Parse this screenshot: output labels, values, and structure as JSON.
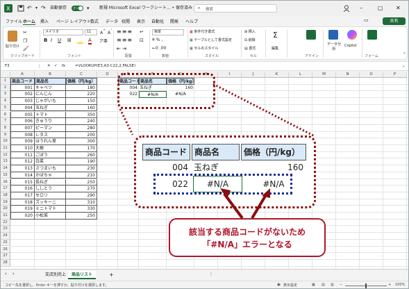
{
  "window": {
    "autosave_label": "自動保存",
    "autosave_state": "オン",
    "doc_title": "新規 Microsoft Excel ワークシート... • 保存済み",
    "search_placeholder": "検索",
    "share_label": "共有"
  },
  "menu": [
    "ファイル",
    "ホーム",
    "挿入",
    "ページ レイアウト",
    "数式",
    "データ",
    "校閲",
    "表示",
    "自動化",
    "開発",
    "ヘルプ"
  ],
  "ribbon": {
    "paste": "貼り付け",
    "font_name": "メイリオ",
    "font_size": "11",
    "number_format": "標準",
    "cond_format": "条件付き書式",
    "table_format": "テーブルとして書式設定",
    "cell_styles": "セルのスタイル",
    "insert": "挿入",
    "delete": "削除",
    "format": "書式",
    "edit": "編集",
    "data_analysis": "データ分析",
    "copilot": "Copilot",
    "groups": [
      "クリップボード",
      "フォント",
      "配置",
      "数値",
      "スタイル",
      "セル",
      "アドイン",
      "フォーム"
    ]
  },
  "formula_bar": {
    "cell_ref": "F3",
    "fx": "fx",
    "formula": "=VLOOKUP(E3,A3:C22,2,FALSE)"
  },
  "columns": [
    "A",
    "B",
    "C",
    "D",
    "E",
    "F",
    "G",
    "H",
    "I",
    "J",
    "K",
    "L",
    "M",
    "N",
    "O",
    "P"
  ],
  "rows": [
    "1",
    "2",
    "3",
    "4",
    "5",
    "6",
    "7",
    "8",
    "9",
    "10",
    "11",
    "12",
    "13",
    "14",
    "15",
    "16",
    "17",
    "18",
    "19",
    "20",
    "21",
    "22",
    "23",
    "24",
    "25",
    "26",
    "27",
    "28"
  ],
  "table": {
    "headers": [
      "商品コード",
      "商品名",
      "価格（円/kg）"
    ],
    "rows": [
      [
        "001",
        "キャベツ",
        "180"
      ],
      [
        "002",
        "にんじん",
        "220"
      ],
      [
        "003",
        "じゃがいも",
        "150"
      ],
      [
        "004",
        "玉ねぎ",
        "160"
      ],
      [
        "005",
        "トマト",
        "350"
      ],
      [
        "006",
        "きゅうり",
        "240"
      ],
      [
        "007",
        "ピーマン",
        "280"
      ],
      [
        "008",
        "レタス",
        "200"
      ],
      [
        "009",
        "ほうれん草",
        "300"
      ],
      [
        "010",
        "大根",
        "170"
      ],
      [
        "011",
        "ごぼう",
        "260"
      ],
      [
        "012",
        "白菜",
        "190"
      ],
      [
        "013",
        "さつまいも",
        "230"
      ],
      [
        "014",
        "かぼちゃ",
        "210"
      ],
      [
        "015",
        "長ねぎ",
        "250"
      ],
      [
        "016",
        "ししとう",
        "270"
      ],
      [
        "017",
        "セロリ",
        "290"
      ],
      [
        "018",
        "ズッキーニ",
        "310"
      ],
      [
        "019",
        "ミニトマト",
        "330"
      ],
      [
        "020",
        "小松菜",
        "250"
      ]
    ]
  },
  "lookup": {
    "headers": [
      "商品コード",
      "商品名",
      "価格（円/kg）"
    ],
    "rows": [
      [
        "004",
        "玉ねぎ",
        "160"
      ],
      [
        "022",
        "#N/A",
        "#N/A"
      ]
    ]
  },
  "callout": {
    "line1": "該当する商品コードがないため",
    "line2": "「#N/A」エラーとなる"
  },
  "sheet_tabs": [
    "支店別売上",
    "商品リスト"
  ],
  "add_sheet": "+",
  "status": {
    "left": "コピー先を選択し、Enter キーを押すか、貼り付けを選択します。",
    "display_settings": "表示設定",
    "zoom": "100%"
  },
  "colors": {
    "accent": "#1d6b3a",
    "callout": "#b1142a",
    "dotted_frame": "#8b0d0d",
    "blue_frame": "#1c2c9a",
    "header_fill": "#d9e9f7"
  }
}
